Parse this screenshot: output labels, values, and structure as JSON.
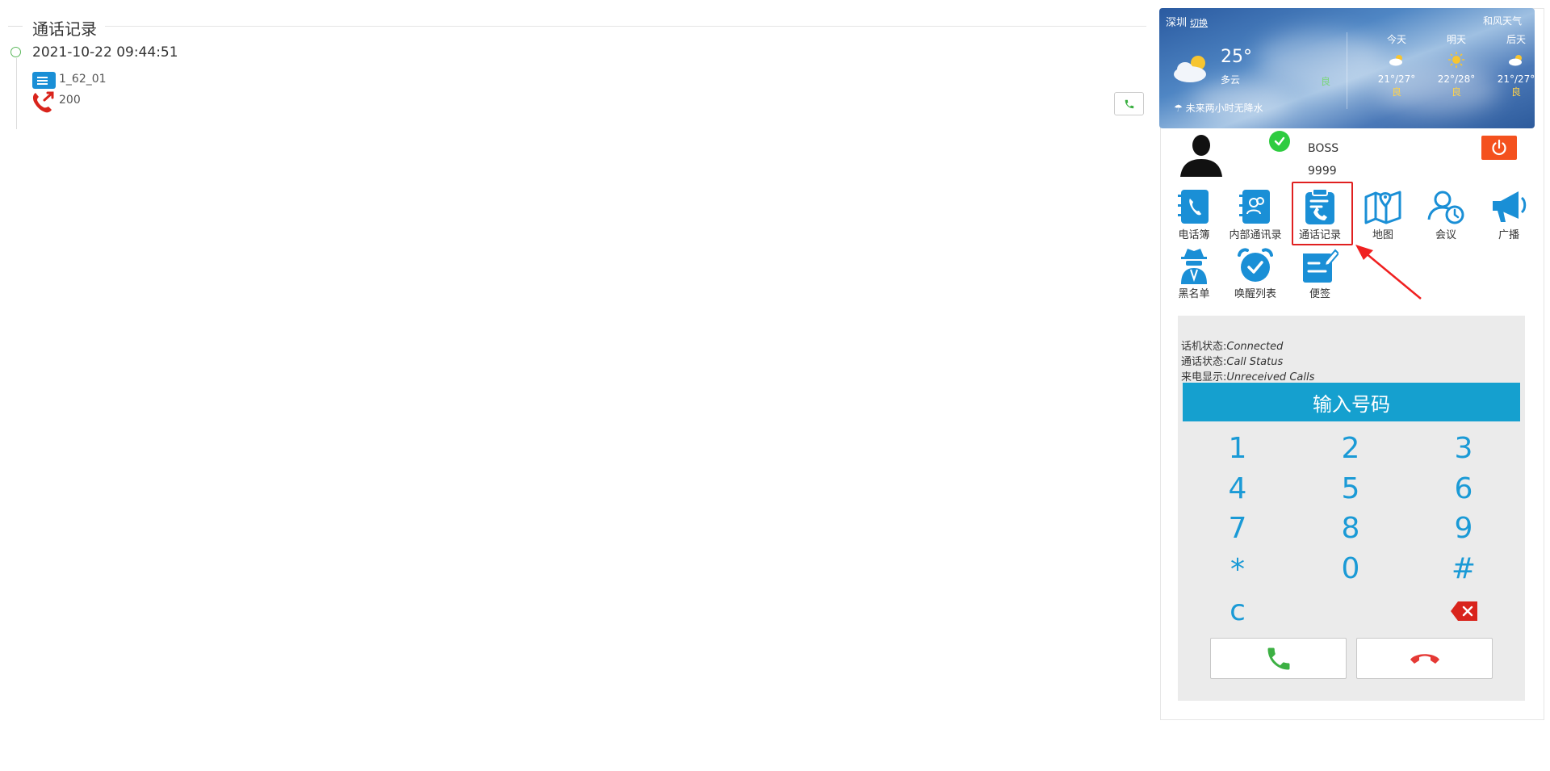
{
  "log": {
    "title": "通话记录",
    "entries": [
      {
        "time": "2021-10-22 09:44:51",
        "extension": "1_62_01",
        "number": "200"
      }
    ]
  },
  "weather": {
    "city": "深圳",
    "switch_label": "切换",
    "temp": "25°",
    "condition": "多云",
    "aqi": "良",
    "rain_note": "未来两小时无降水",
    "brand": "和风天气",
    "days": [
      {
        "label": "今天",
        "icon": "partly-cloudy-icon",
        "range": "21°/27°",
        "quality": "良"
      },
      {
        "label": "明天",
        "icon": "sun-icon",
        "range": "22°/28°",
        "quality": "良"
      },
      {
        "label": "后天",
        "icon": "partly-cloudy-icon",
        "range": "21°/27°",
        "quality": "良"
      }
    ]
  },
  "user": {
    "name": "BOSS",
    "extension": "9999"
  },
  "apps": [
    {
      "label": "电话簿",
      "icon": "phonebook-icon"
    },
    {
      "label": "内部通讯录",
      "icon": "internal-contacts-icon"
    },
    {
      "label": "通话记录",
      "icon": "call-log-icon",
      "selected": true
    },
    {
      "label": "地图",
      "icon": "map-icon"
    },
    {
      "label": "会议",
      "icon": "meeting-icon"
    },
    {
      "label": "广播",
      "icon": "broadcast-icon"
    },
    {
      "label": "黑名单",
      "icon": "blacklist-icon"
    },
    {
      "label": "唤醒列表",
      "icon": "wakeup-alarm-icon"
    },
    {
      "label": "便签",
      "icon": "note-icon"
    }
  ],
  "status": {
    "phone_label": "话机状态:",
    "phone_value": "Connected",
    "call_label": "通话状态:",
    "call_value": "Call Status",
    "caller_label": "来电显示:",
    "caller_value": "Unreceived Calls"
  },
  "dialer": {
    "input_label": "输入号码",
    "keys": [
      "1",
      "2",
      "3",
      "4",
      "5",
      "6",
      "7",
      "8",
      "9",
      "*",
      "0",
      "#"
    ],
    "clear_key": "c"
  },
  "colors": {
    "accent": "#15a0cf",
    "app_blue": "#1a8fd6",
    "power": "#f4511e",
    "highlight": "#e02020"
  }
}
